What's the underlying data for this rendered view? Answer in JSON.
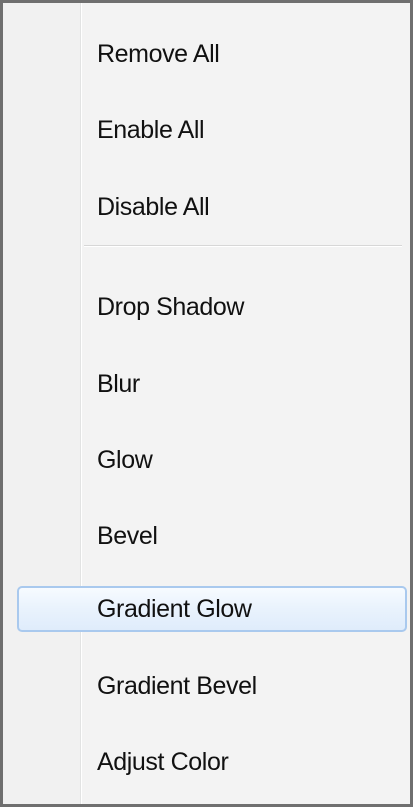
{
  "menu": {
    "group1": [
      {
        "label": "Remove All"
      },
      {
        "label": "Enable All"
      },
      {
        "label": "Disable All"
      }
    ],
    "group2": [
      {
        "label": "Drop Shadow"
      },
      {
        "label": "Blur"
      },
      {
        "label": "Glow"
      },
      {
        "label": "Bevel"
      },
      {
        "label": "Gradient Glow",
        "highlighted": true
      },
      {
        "label": "Gradient Bevel"
      },
      {
        "label": "Adjust Color"
      }
    ]
  },
  "colors": {
    "menu_background": "#f1f1f1",
    "border": "#6f6f6f",
    "hover_border": "#a9c9ee",
    "hover_fill": "#eaf3fd",
    "text": "#111111"
  }
}
